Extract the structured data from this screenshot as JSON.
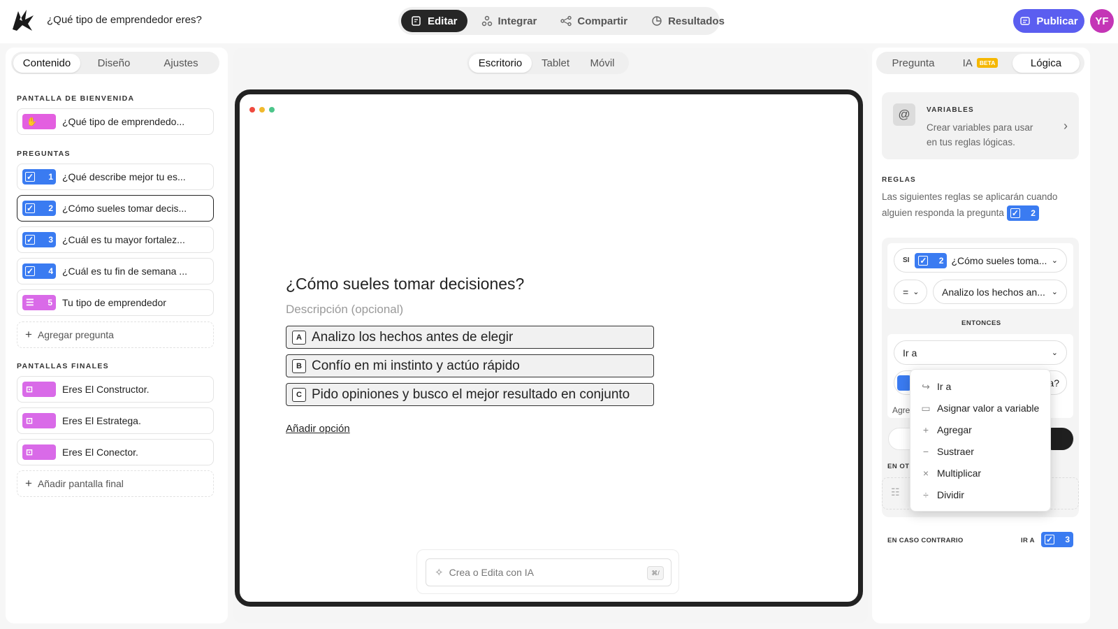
{
  "header": {
    "form_title": "¿Qué tipo de emprendedor eres?",
    "tabs": [
      {
        "label": "Editar",
        "icon": "edit-icon"
      },
      {
        "label": "Integrar",
        "icon": "integrate-icon"
      },
      {
        "label": "Compartir",
        "icon": "share-icon"
      },
      {
        "label": "Resultados",
        "icon": "results-icon"
      }
    ],
    "publish_label": "Publicar",
    "avatar_initials": "YF",
    "accent": "#5b5ef0"
  },
  "left": {
    "tabs": [
      "Contenido",
      "Diseño",
      "Ajustes"
    ],
    "welcome_title": "PANTALLA DE BIENVENIDA",
    "welcome_item": "¿Qué tipo de emprendedo...",
    "questions_title": "PREGUNTAS",
    "questions": [
      {
        "num": "1",
        "label": "¿Qué describe mejor tu es..."
      },
      {
        "num": "2",
        "label": "¿Cómo sueles tomar decis..."
      },
      {
        "num": "3",
        "label": "¿Cuál es tu mayor fortalez..."
      },
      {
        "num": "4",
        "label": "¿Cuál es tu fin de semana ..."
      },
      {
        "num": "5",
        "label": "Tu tipo de emprendedor"
      }
    ],
    "add_question": "Agregar pregunta",
    "endings_title": "PANTALLAS FINALES",
    "endings": [
      "Eres El Constructor.",
      "Eres El Estratega.",
      "Eres El Conector."
    ],
    "add_ending": "Añadir pantalla final"
  },
  "preview": {
    "devices": [
      "Escritorio",
      "Tablet",
      "Móvil"
    ],
    "question_title": "¿Cómo sueles tomar decisiones?",
    "description_placeholder": "Descripción (opcional)",
    "options": [
      {
        "key": "A",
        "label": "Analizo los hechos antes de elegir"
      },
      {
        "key": "B",
        "label": "Confío en mi instinto y actúo rápido"
      },
      {
        "key": "C",
        "label": "Pido opiniones y busco el mejor resultado en conjunto"
      }
    ],
    "add_option": "Añadir opción",
    "ai_placeholder": "Crea o Edita con IA",
    "ai_shortcut": "⌘/"
  },
  "right": {
    "tabs": [
      "Pregunta",
      "IA",
      "Lógica"
    ],
    "ia_badge": "BETA",
    "variables_title": "VARIABLES",
    "variables_desc_1": "Crear variables para usar",
    "variables_desc_2": "en tus reglas lógicas.",
    "rules_title": "REGLAS",
    "rules_desc_1": "Las siguientes reglas se aplicarán cuando",
    "rules_desc_2": "alguien responda la pregunta",
    "rules_q_num": "2",
    "si_label": "SI",
    "si_question": "¿Cómo sueles toma...",
    "operator": "=",
    "answer": "Analizo los hechos an...",
    "then_label": "ENTONCES",
    "action": "Ir a",
    "partial_right": "a?",
    "partial_agre": "Agre",
    "partial_en_ot": "EN OT",
    "else_label": "EN CASO CONTRARIO",
    "else_goto": "IR A",
    "else_num": "3"
  },
  "menu": {
    "items": [
      {
        "label": "Ir a",
        "icon": "goto-icon"
      },
      {
        "label": "Asignar valor a variable",
        "icon": "assign-icon"
      },
      {
        "label": "Agregar",
        "icon": "plus-icon"
      },
      {
        "label": "Sustraer",
        "icon": "minus-icon"
      },
      {
        "label": "Multiplicar",
        "icon": "multiply-icon"
      },
      {
        "label": "Dividir",
        "icon": "divide-icon"
      }
    ]
  }
}
